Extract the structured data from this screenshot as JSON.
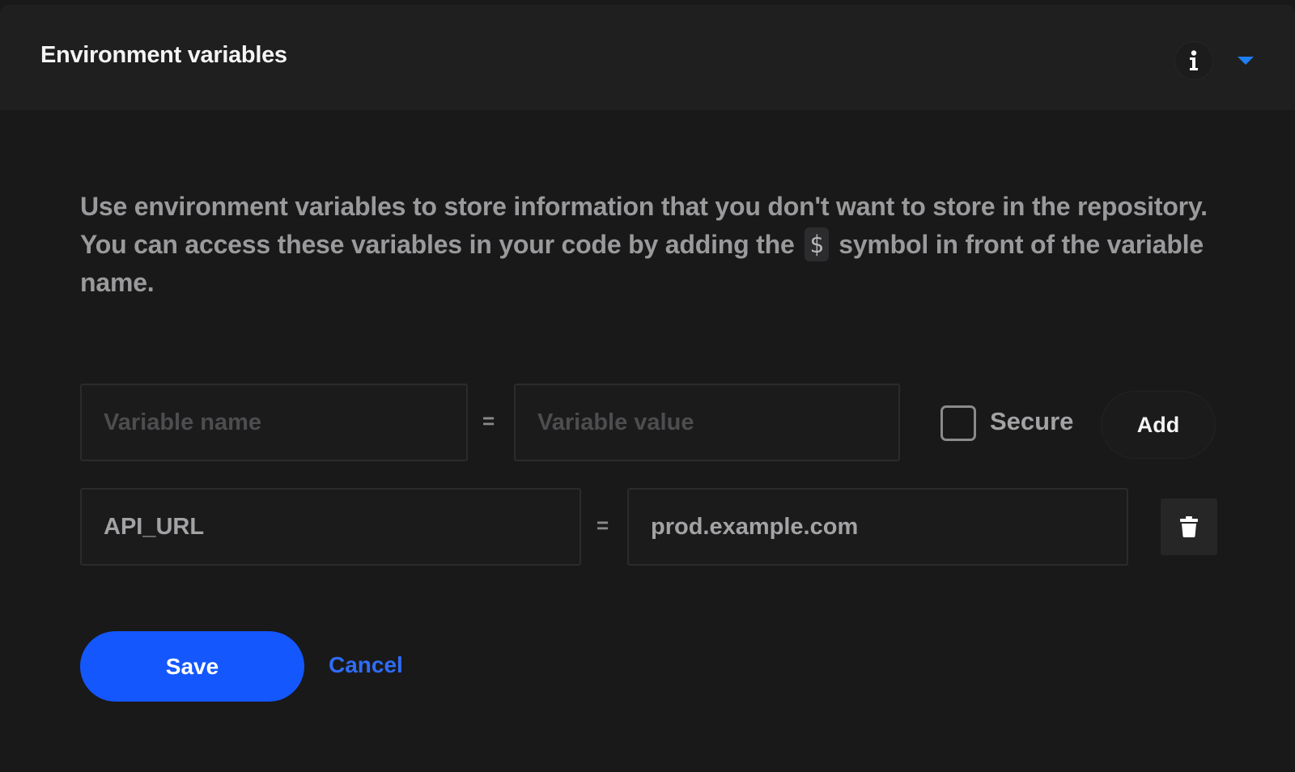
{
  "header": {
    "title": "Environment variables",
    "info_icon": "info-icon",
    "toggle_icon": "chevron-down-icon",
    "accent": "#1e7ff0"
  },
  "description": {
    "before": "Use environment variables to store information that you don't want to store in the repository. You can access these variables in your code by adding the",
    "code": "$",
    "after": "symbol in front of the variable name."
  },
  "new_variable": {
    "name_placeholder": "Variable name",
    "name_value": "",
    "equals": "=",
    "value_placeholder": "Variable value",
    "value_value": "",
    "secure_label": "Secure",
    "secure_checked": false,
    "add_label": "Add"
  },
  "variables": [
    {
      "name": "API_URL",
      "equals": "=",
      "value": "prod.example.com",
      "delete_icon": "trash-icon"
    }
  ],
  "actions": {
    "save_label": "Save",
    "cancel_label": "Cancel",
    "primary_color": "#1457fd"
  }
}
